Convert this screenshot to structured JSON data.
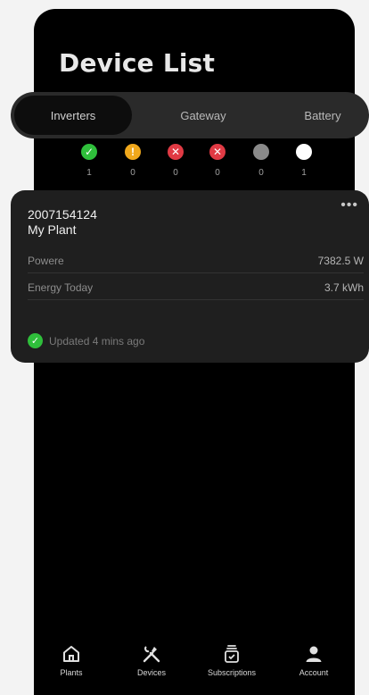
{
  "page": {
    "title": "Device List"
  },
  "tabs": [
    {
      "label": "Inverters",
      "active": true
    },
    {
      "label": "Gateway",
      "active": false
    },
    {
      "label": "Battery",
      "active": false
    }
  ],
  "status": [
    {
      "icon": "check-circle-icon",
      "glyph": "✓",
      "color": "#2fbf3b",
      "count": "1"
    },
    {
      "icon": "warning-circle-icon",
      "glyph": "!",
      "color": "#f0a81c",
      "count": "0"
    },
    {
      "icon": "error-circle-icon",
      "glyph": "✕",
      "color": "#e03a44",
      "count": "0"
    },
    {
      "icon": "fault-circle-icon",
      "glyph": "✕",
      "color": "#e03a44",
      "count": "0"
    },
    {
      "icon": "offline-circle-icon",
      "glyph": "",
      "color": "#8a8a8a",
      "count": "0"
    },
    {
      "icon": "standby-circle-icon",
      "glyph": "",
      "color": "#ffffff",
      "count": "1"
    }
  ],
  "device": {
    "serial": "2007154124",
    "plant": "My Plant",
    "power_label": "Powere",
    "power_value": "7382.5 W",
    "energy_label": "Energy Today",
    "energy_value": "3.7 kWh",
    "updated": "Updated 4 mins ago",
    "more_icon": "more-dots-icon"
  },
  "nav": [
    {
      "label": "Plants",
      "icon": "home-icon"
    },
    {
      "label": "Devices",
      "icon": "tools-icon"
    },
    {
      "label": "Subscriptions",
      "icon": "subscriptions-icon"
    },
    {
      "label": "Account",
      "icon": "user-icon"
    }
  ]
}
